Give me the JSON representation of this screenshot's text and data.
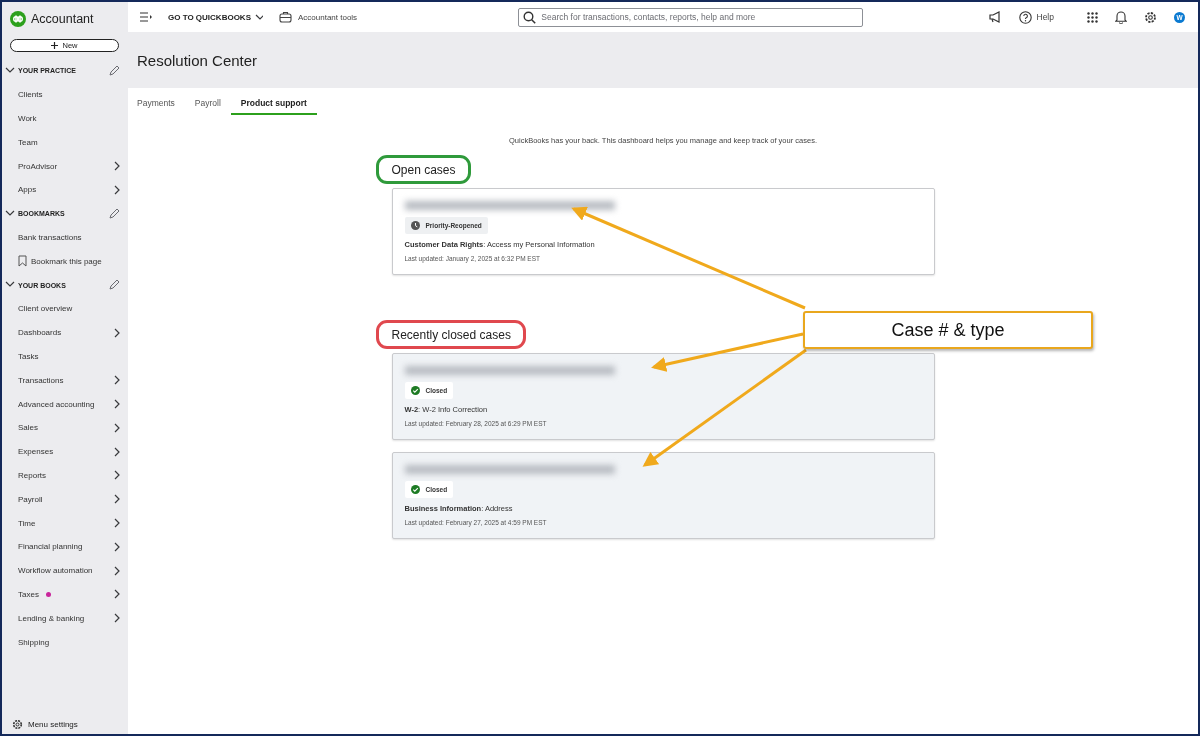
{
  "app": {
    "name": "Accountant"
  },
  "new_button": {
    "label": "New"
  },
  "sidebar": {
    "sections": [
      {
        "title": "YOUR PRACTICE",
        "expanded": true,
        "items": [
          {
            "label": "Clients",
            "kind": "link",
            "has_submenu": false
          },
          {
            "label": "Work",
            "kind": "link",
            "has_submenu": false
          },
          {
            "label": "Team",
            "kind": "link",
            "has_submenu": false
          },
          {
            "label": "ProAdvisor",
            "kind": "link",
            "has_submenu": true
          },
          {
            "label": "Apps",
            "kind": "link",
            "has_submenu": true
          }
        ]
      },
      {
        "title": "BOOKMARKS",
        "expanded": true,
        "items": [
          {
            "label": "Bank transactions",
            "kind": "link",
            "has_submenu": false
          },
          {
            "label": "Bookmark this page",
            "kind": "bookmark",
            "has_submenu": false
          }
        ]
      },
      {
        "title": "YOUR BOOKS",
        "expanded": true,
        "items": [
          {
            "label": "Client overview",
            "kind": "link",
            "has_submenu": false
          },
          {
            "label": "Dashboards",
            "kind": "link",
            "has_submenu": true
          },
          {
            "label": "Tasks",
            "kind": "link",
            "has_submenu": false
          },
          {
            "label": "Transactions",
            "kind": "link",
            "has_submenu": true
          },
          {
            "label": "Advanced accounting",
            "kind": "link",
            "has_submenu": true
          },
          {
            "label": "Sales",
            "kind": "link",
            "has_submenu": true
          },
          {
            "label": "Expenses",
            "kind": "link",
            "has_submenu": true
          },
          {
            "label": "Reports",
            "kind": "link",
            "has_submenu": true
          },
          {
            "label": "Payroll",
            "kind": "link",
            "has_submenu": true
          },
          {
            "label": "Time",
            "kind": "link",
            "has_submenu": true
          },
          {
            "label": "Financial planning",
            "kind": "link",
            "has_submenu": true
          },
          {
            "label": "Workflow automation",
            "kind": "link",
            "has_submenu": true
          },
          {
            "label": "Taxes",
            "kind": "link",
            "has_submenu": true,
            "notification": true
          },
          {
            "label": "Lending & banking",
            "kind": "link",
            "has_submenu": true
          },
          {
            "label": "Shipping",
            "kind": "link",
            "has_submenu": false
          }
        ]
      }
    ],
    "footer": "Menu settings"
  },
  "topbar": {
    "go_to": "GO TO QUICKBOOKS",
    "tools": "Accountant tools",
    "search": {
      "placeholder": "Search for transactions, contacts, reports, help and more"
    },
    "help": "Help",
    "avatar": "W"
  },
  "page": {
    "title": "Resolution Center",
    "tabs": [
      {
        "label": "Payments",
        "selected": false
      },
      {
        "label": "Payroll",
        "selected": false
      },
      {
        "label": "Product support",
        "selected": true
      }
    ],
    "intro": "QuickBooks has your back. This dashboard helps you manage and keep track of your cases.",
    "sections": [
      {
        "title": "Open cases",
        "color": "#2f9a3b",
        "cases": [
          {
            "status": "Priority-Reopened",
            "kind": "open",
            "line": "**Customer Data Rights**: Access my Personal Information",
            "updated": "Last updated: January 2, 2025 at 6:32 PM EST"
          }
        ]
      },
      {
        "title": "Recently closed cases",
        "color": "#e0484e",
        "cases": [
          {
            "status": "Closed",
            "kind": "closed",
            "line": "**W-2**: W-2 Info Correction",
            "updated": "Last updated: February 28, 2025 at 6:29 PM EST"
          },
          {
            "status": "Closed",
            "kind": "closed",
            "line": "**Business Information**: Address",
            "updated": "Last updated: February 27, 2025 at 4:59 PM EST"
          }
        ]
      }
    ]
  },
  "annotation": {
    "label": "Case # & type"
  }
}
